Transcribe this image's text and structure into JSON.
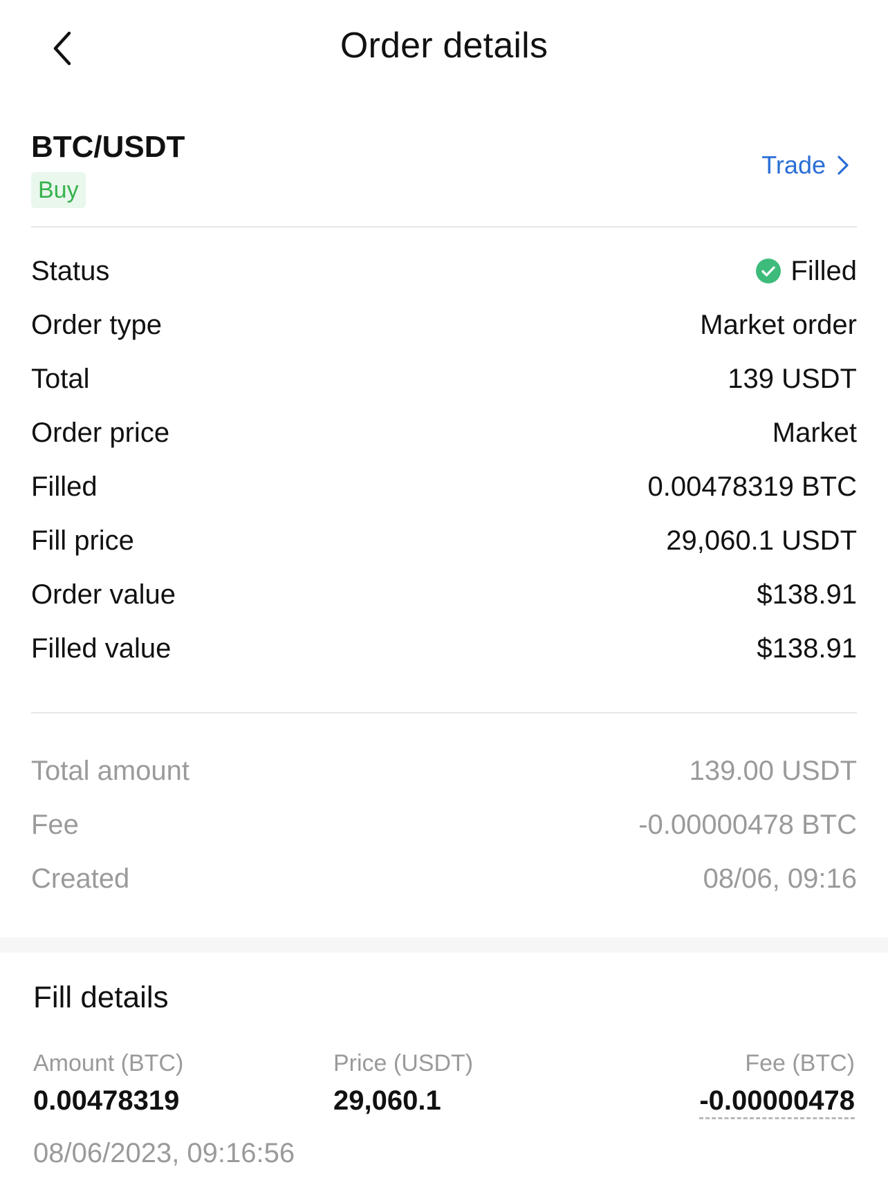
{
  "header": {
    "title": "Order details",
    "back_icon": "chevron-left-icon"
  },
  "pair": {
    "symbol": "BTC/USDT",
    "side": "Buy",
    "trade_link": "Trade",
    "side_color": "#37b24d"
  },
  "details": [
    {
      "label": "Status",
      "value": "Filled",
      "icon": "check-circle-icon"
    },
    {
      "label": "Order type",
      "value": "Market order"
    },
    {
      "label": "Total",
      "value": "139 USDT"
    },
    {
      "label": "Order price",
      "value": "Market"
    },
    {
      "label": "Filled",
      "value": "0.00478319 BTC"
    },
    {
      "label": "Fill price",
      "value": "29,060.1 USDT"
    },
    {
      "label": "Order value",
      "value": "$138.91"
    },
    {
      "label": "Filled value",
      "value": "$138.91"
    }
  ],
  "summary": [
    {
      "label": "Total amount",
      "value": "139.00 USDT"
    },
    {
      "label": "Fee",
      "value": "-0.00000478 BTC"
    },
    {
      "label": "Created",
      "value": "08/06, 09:16"
    }
  ],
  "fill_details": {
    "title": "Fill details",
    "amount_header": "Amount (BTC)",
    "amount_value": "0.00478319",
    "price_header": "Price (USDT)",
    "price_value": "29,060.1",
    "fee_header": "Fee (BTC)",
    "fee_value": "-0.00000478",
    "timestamp": "08/06/2023, 09:16:56"
  },
  "colors": {
    "accent": "#2a6ed6",
    "status_ok": "#3dbb7a",
    "muted": "#9a9a9a"
  }
}
